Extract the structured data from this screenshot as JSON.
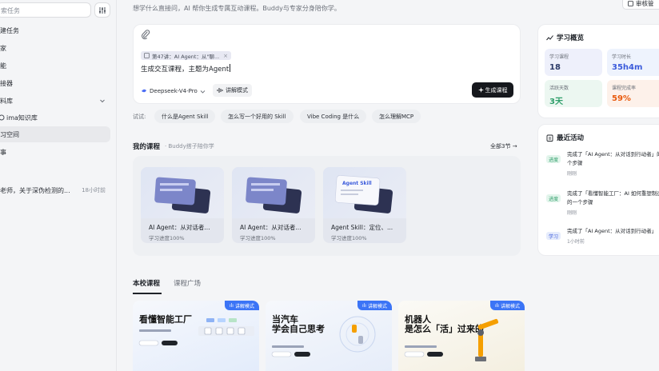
{
  "sidebar": {
    "search_placeholder": "索任务",
    "items": [
      {
        "label": "建任务"
      },
      {
        "label": "家"
      },
      {
        "label": "能"
      },
      {
        "label": "接器"
      },
      {
        "label": "料库"
      },
      {
        "label": "ima知识库"
      },
      {
        "label": "习空间"
      },
      {
        "label": "事"
      }
    ],
    "recent": {
      "label": "老师，关于深伪检测的...",
      "time": "18小时前"
    }
  },
  "main": {
    "subtitle": "想学什么直接问，AI 帮你生成专属互动课程。Buddy与专家分身陪你学。",
    "composer": {
      "chip_label": "第47讲：AI Agent：从\"聊...",
      "chip_close": "×",
      "prompt_text": "生成交互课程，主题为Agent",
      "model_label": "Deepseek-V4-Pro",
      "explain_label": "讲解模式",
      "generate_label": "生成课程"
    },
    "try_label": "试试:",
    "suggestions": [
      "什么是Agent Skill",
      "怎么写一个好用的 Skill",
      "Vibe Coding 是什么",
      "怎么理解MCP"
    ],
    "my_courses": {
      "title": "我的课程",
      "subtitle": "· Buddy搭子陪你学",
      "see_all": "全部3节",
      "cards": [
        {
          "title": "AI Agent：从对话者...",
          "progress": "学习进度100%"
        },
        {
          "title": "AI Agent：从对话者...",
          "progress": "学习进度100%"
        },
        {
          "title": "Agent Skill：定位、...",
          "progress": "学习进度100%",
          "thumb_text": "Agent Skill"
        }
      ]
    },
    "tabs": [
      {
        "label": "本校课程"
      },
      {
        "label": "课程广场"
      }
    ],
    "market": [
      {
        "badge": "讲解模式",
        "title": "看懂智能工厂"
      },
      {
        "badge": "讲解模式",
        "title": "当汽车\n学会自己思考"
      },
      {
        "badge": "讲解模式",
        "title": "机器人\n是怎么「活」过来的"
      }
    ]
  },
  "right": {
    "review_label": "审核管",
    "overview": {
      "title": "学习概览",
      "stats": [
        {
          "label": "学习课程",
          "value": "18",
          "color": "#2b3a67",
          "bg": "#eef0fb"
        },
        {
          "label": "学习时长",
          "value": "35h4m",
          "color": "#3b5bdb",
          "bg": "#eef3fd"
        },
        {
          "label": "活跃天数",
          "value": "3天",
          "color": "#2f9e6a",
          "bg": "#ecf7f1"
        },
        {
          "label": "课程完成率",
          "value": "59%",
          "color": "#e8590c",
          "bg": "#fdf1ea"
        }
      ]
    },
    "activity": {
      "title": "最近活动",
      "items": [
        {
          "badge": "进度",
          "badge_color": "#2f9e6a",
          "badge_bg": "#e3f5ec",
          "text": "完成了「AI Agent：从对话到行动者」的一个步骤",
          "time": "刚刚"
        },
        {
          "badge": "进度",
          "badge_color": "#2f9e6a",
          "badge_bg": "#e3f5ec",
          "text": "完成了「看懂智能工厂：AI 如何重塑制造业」的一个步骤",
          "time": "刚刚"
        },
        {
          "badge": "学习",
          "badge_color": "#3b5bdb",
          "badge_bg": "#e6ecfc",
          "text": "完成了「AI Agent：从对话到行动者」",
          "time": "1小时前"
        }
      ]
    }
  }
}
